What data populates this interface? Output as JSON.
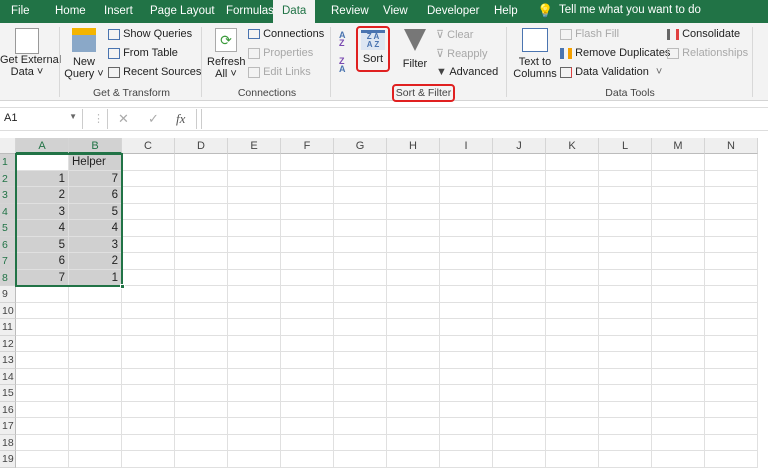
{
  "tabs": [
    "File",
    "Home",
    "Insert",
    "Page Layout",
    "Formulas",
    "Data",
    "Review",
    "View",
    "Developer",
    "Help"
  ],
  "active_tab": "Data",
  "tell_me": "Tell me what you want to do",
  "ribbon": {
    "get_external": [
      "Get External",
      "Data ˅"
    ],
    "new_query": [
      "New",
      "Query ˅"
    ],
    "show_queries": "Show Queries",
    "from_table": "From Table",
    "recent_sources": "Recent Sources",
    "get_transform": "Get & Transform",
    "refresh": [
      "Refresh",
      "All ˅"
    ],
    "connections": "Connections",
    "properties": "Properties",
    "edit_links": "Edit Links",
    "connections_group": "Connections",
    "sort": "Sort",
    "filter": "Filter",
    "clear": "Clear",
    "reapply": "Reapply",
    "advanced": "Advanced",
    "sort_filter_group": "Sort & Filter",
    "text_to_columns": [
      "Text to",
      "Columns"
    ],
    "flash_fill": "Flash Fill",
    "remove_duplicates": "Remove Duplicates",
    "data_validation": "Data Validation",
    "consolidate": "Consolidate",
    "relationships": "Relationships",
    "data_tools_group": "Data Tools",
    "highlight_color": "#e02020"
  },
  "formula_bar": {
    "name_box": "A1",
    "formula": ""
  },
  "columns": [
    "A",
    "B",
    "C",
    "D",
    "E",
    "F",
    "G",
    "H",
    "I",
    "J",
    "K",
    "L",
    "M",
    "N"
  ],
  "rows": [
    "1",
    "2",
    "3",
    "4",
    "5",
    "6",
    "7",
    "8",
    "9",
    "10",
    "11",
    "12",
    "13",
    "14",
    "15",
    "16",
    "17",
    "18",
    "19"
  ],
  "cells": [
    [
      "",
      "Helper"
    ],
    [
      "1",
      "7"
    ],
    [
      "2",
      "6"
    ],
    [
      "3",
      "5"
    ],
    [
      "4",
      "4"
    ],
    [
      "5",
      "3"
    ],
    [
      "6",
      "2"
    ],
    [
      "7",
      "1"
    ]
  ],
  "selection": "A1:B8",
  "accent": "#217346"
}
